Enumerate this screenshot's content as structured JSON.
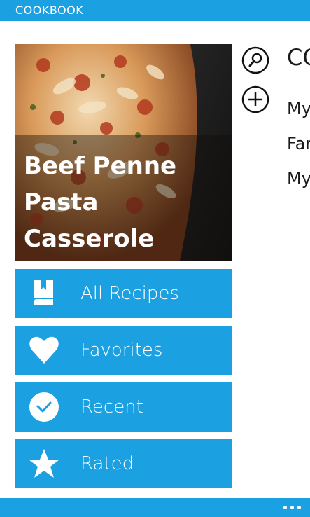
{
  "app": {
    "title": "COOKBOOK",
    "accent_color": "#1ba1e2"
  },
  "featured": {
    "title": "Beef Penne\nPasta\nCasserole",
    "image_description_icon": "casserole-photo"
  },
  "menu": [
    {
      "label": "All Recipes",
      "icon": "book-icon"
    },
    {
      "label": "Favorites",
      "icon": "heart-icon"
    },
    {
      "label": "Recent",
      "icon": "clock-icon"
    },
    {
      "label": "Rated",
      "icon": "star-icon"
    }
  ],
  "side_panel": {
    "heading": "CO",
    "search_icon": "search-icon",
    "add_icon": "add-icon",
    "entries": [
      "My",
      "Far",
      "My"
    ]
  },
  "app_bar": {
    "more_icon": "ellipsis-icon"
  }
}
